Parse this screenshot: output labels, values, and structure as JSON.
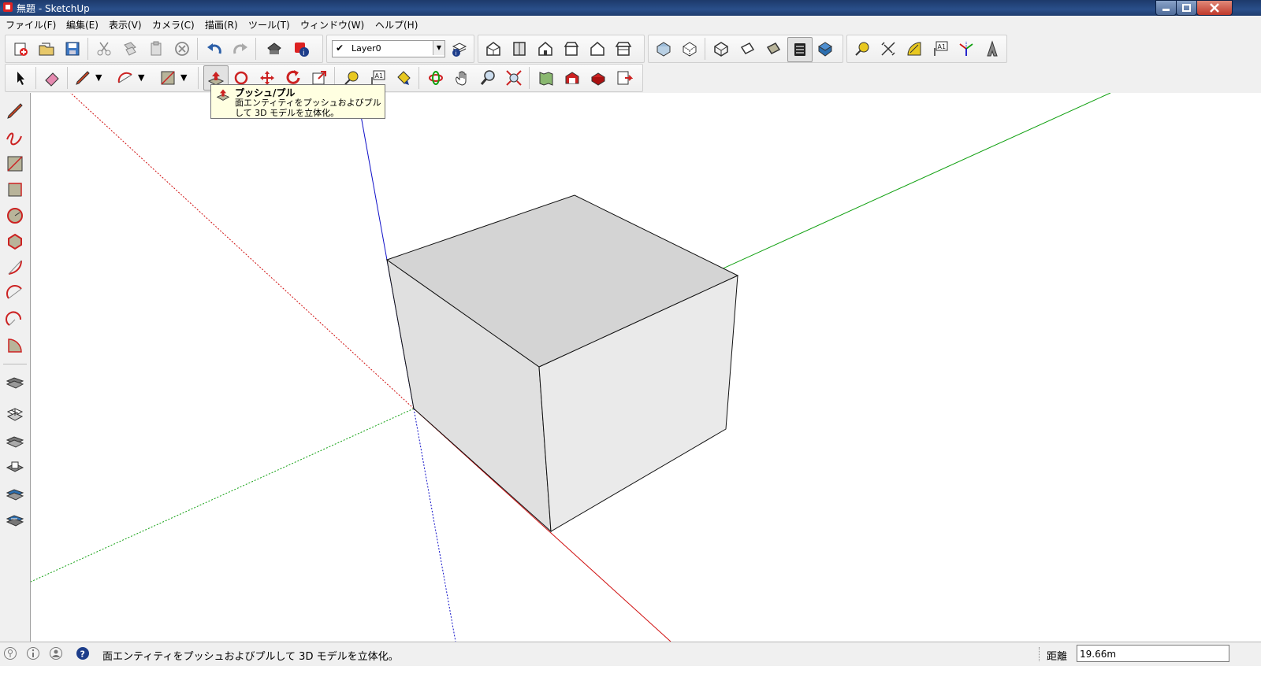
{
  "window": {
    "title": "無題 - SketchUp"
  },
  "menu": [
    "ファイル(F)",
    "編集(E)",
    "表示(V)",
    "カメラ(C)",
    "描画(R)",
    "ツール(T)",
    "ウィンドウ(W)",
    "ヘルプ(H)"
  ],
  "toolbar": {
    "layer_value": "Layer0",
    "row1_icons": [
      "new-icon",
      "open-icon",
      "save-icon",
      "cut-icon",
      "copy-icon",
      "paste-icon",
      "erase-icon",
      "undo-icon",
      "redo-icon",
      "print-icon",
      "model-info-icon",
      "layer-manager-icon",
      "iso-view-icon",
      "top-view-icon",
      "front-view-icon",
      "right-view-icon",
      "back-view-icon",
      "left-view-icon",
      "xray-icon",
      "wireframe-icon",
      "hidden-line-icon",
      "shaded-icon",
      "textured-icon",
      "monochrome-icon",
      "tape-measure-icon",
      "dimension-icon",
      "protractor-icon",
      "text-icon",
      "axes-icon",
      "3d-text-icon"
    ],
    "row2_icons": [
      "select-icon",
      "eraser-icon",
      "pencil-icon",
      "arc-icon",
      "rectangle-icon",
      "push-pull-icon",
      "follow-me-icon",
      "move-icon",
      "rotate-icon",
      "scale-icon",
      "tape-icon",
      "text-label-icon",
      "paint-bucket-icon",
      "orbit-icon",
      "pan-icon",
      "zoom-icon",
      "zoom-extents-icon",
      "map-icon",
      "warehouse-icon",
      "components-icon",
      "extensions-icon"
    ]
  },
  "sidebar_icons": [
    "line-icon",
    "freehand-icon",
    "rectangle-icon",
    "rotated-rectangle-icon",
    "circle-icon",
    "polygon-icon",
    "arc-icon",
    "two-point-arc-icon",
    "three-point-arc-icon",
    "pie-icon",
    "sandbox-from-contours-icon",
    "sandbox-from-scratch-icon",
    "smoove-icon",
    "stamp-icon",
    "drape-icon",
    "add-detail-icon"
  ],
  "tooltip": {
    "title": "プッシュ/プル",
    "description": "面エンティティをプッシュおよびプルして 3D モデルを立体化。"
  },
  "status": {
    "message": "面エンティティをプッシュおよびプルして 3D モデルを立体化。",
    "measure_label": "距離",
    "measure_value": "19.66m"
  },
  "colors": {
    "axis_red": "#d01010",
    "axis_green": "#10a010",
    "axis_blue": "#1010c8",
    "face_top": "#d4d4d4",
    "face_left": "#e0e0e0",
    "face_right": "#eaeaea"
  }
}
